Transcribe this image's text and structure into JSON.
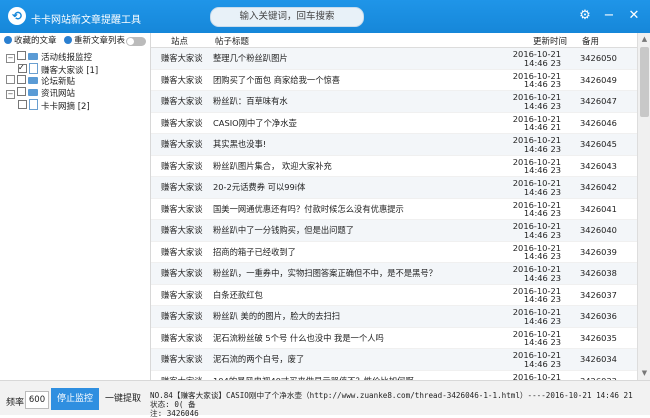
{
  "app": {
    "title": "卡卡网站新文章提醒工具",
    "search_placeholder": "输入关键词，回车搜索"
  },
  "toolbar": {
    "favorites": "收藏的文章",
    "reset_list": "重新文章列表"
  },
  "tree": [
    {
      "label": "活动线报监控",
      "level": 1,
      "expander": "−",
      "checked": false,
      "type": "folder"
    },
    {
      "label": "赚客大家谈 [1]",
      "level": 2,
      "expander": "",
      "checked": true,
      "type": "doc"
    },
    {
      "label": "论坛新贴",
      "level": 1,
      "expander": "",
      "checked": false,
      "type": "folder"
    },
    {
      "label": "资讯网站",
      "level": 1,
      "expander": "−",
      "checked": false,
      "type": "folder"
    },
    {
      "label": "卡卡网摘 [2]",
      "level": 2,
      "expander": "",
      "checked": false,
      "type": "doc"
    }
  ],
  "grid": {
    "columns": {
      "site": "站点",
      "title": "帖子标题",
      "time": "更新时间",
      "id": "备用"
    },
    "rows": [
      {
        "site": "赚客大家谈",
        "title": "整理几个粉丝趴图片",
        "date": "2016-10-21",
        "time": "14:46 23",
        "id": "3426050"
      },
      {
        "site": "赚客大家谈",
        "title": "团购买了个面包  商家给我一个惊喜",
        "date": "2016-10-21",
        "time": "14:46 23",
        "id": "3426049"
      },
      {
        "site": "赚客大家谈",
        "title": "粉丝趴：百草味有水",
        "date": "2016-10-21",
        "time": "14:46 23",
        "id": "3426047"
      },
      {
        "site": "赚客大家谈",
        "title": "CASIO刚中了个净水壶",
        "date": "2016-10-21",
        "time": "14:46 21",
        "id": "3426046"
      },
      {
        "site": "赚客大家谈",
        "title": "其实黑也没事!",
        "date": "2016-10-21",
        "time": "14:46 23",
        "id": "3426045"
      },
      {
        "site": "赚客大家谈",
        "title": "粉丝趴图片集合， 欢迎大家补充",
        "date": "2016-10-21",
        "time": "14:46 23",
        "id": "3426043"
      },
      {
        "site": "赚客大家谈",
        "title": "20-2元话费券  可以99i体",
        "date": "2016-10-21",
        "time": "14:46 23",
        "id": "3426042"
      },
      {
        "site": "赚客大家谈",
        "title": "国美一网通优惠还有吗？付款时候怎么没有优惠提示",
        "date": "2016-10-21",
        "time": "14:46 23",
        "id": "3426041"
      },
      {
        "site": "赚客大家谈",
        "title": "粉丝趴中了一分钱购买，但是出问题了",
        "date": "2016-10-21",
        "time": "14:46 23",
        "id": "3426040"
      },
      {
        "site": "赚客大家谈",
        "title": "招商的箱子已经收到了",
        "date": "2016-10-21",
        "time": "14:46 23",
        "id": "3426039"
      },
      {
        "site": "赚客大家谈",
        "title": "粉丝趴，一重券中，实物扫图答案正确但不中，是不是黑号？",
        "date": "2016-10-21",
        "time": "14:46 23",
        "id": "3426038"
      },
      {
        "site": "赚客大家谈",
        "title": "白条还款红包",
        "date": "2016-10-21",
        "time": "14:46 23",
        "id": "3426037"
      },
      {
        "site": "赚客大家谈",
        "title": "粉丝趴 美的的图片，脸大的去扫扫",
        "date": "2016-10-21",
        "time": "14:46 23",
        "id": "3426036"
      },
      {
        "site": "赚客大家谈",
        "title": "泥石流粉丝破 5个号 什么也没中 我是一个人吗",
        "date": "2016-10-21",
        "time": "14:46 23",
        "id": "3426035"
      },
      {
        "site": "赚客大家谈",
        "title": "泥石流的两个白号，废了",
        "date": "2016-10-21",
        "time": "14:46 23",
        "id": "3426034"
      },
      {
        "site": "赚客大家谈",
        "title": "104的暴风电视40寸买来做显示器值不？性价比如何啊",
        "date": "2016-10-21",
        "time": "14:46 23",
        "id": "3426033"
      },
      {
        "site": "赚客大家谈",
        "title": "超越流量用活动",
        "date": "2016-10-21",
        "time": "14:46 23",
        "id": "3426032"
      }
    ]
  },
  "bottom": {
    "freq_label": "频率",
    "freq_value": "600",
    "stop_label": "停止监控",
    "fetch_label": "一键提取",
    "log_line1": "NO.84【赚客大家谈】CASIO刚中了个净水壶（http://www.zuanke8.com/thread-3426046-1-1.html）----2016-10-21 14:46 21 状态: 0( 备",
    "log_line2": "注: 3426046"
  }
}
